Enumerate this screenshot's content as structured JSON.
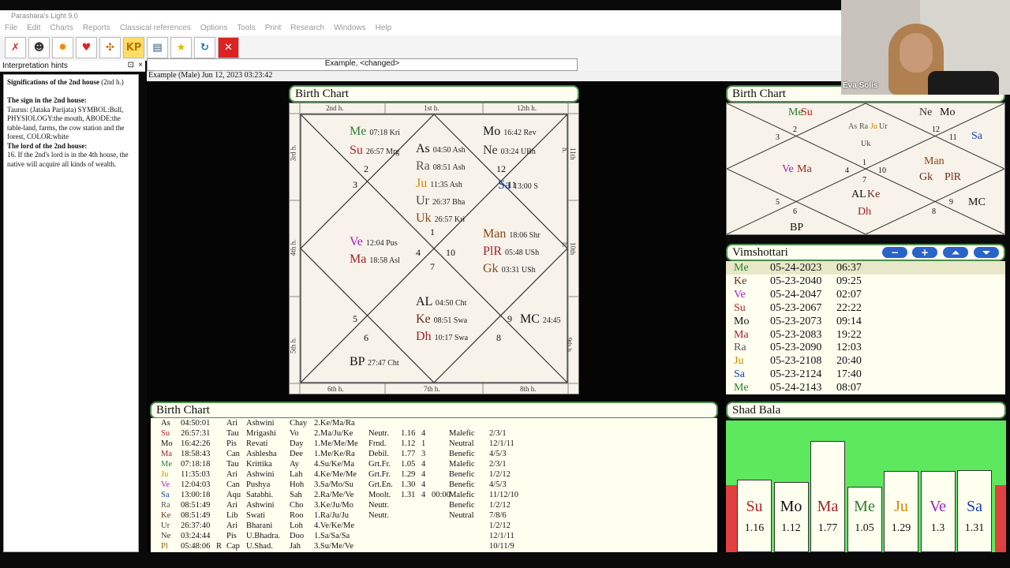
{
  "app": {
    "title": "Parashara's Light 9.0",
    "menu": [
      "File",
      "Edit",
      "Charts",
      "Reports",
      "Classical references",
      "Options",
      "Tools",
      "Print",
      "Research",
      "Windows",
      "Help"
    ],
    "toolbar": [
      "tools-icon",
      "profile-icon",
      "sun-icon",
      "heart-icon",
      "wheel-icon",
      "kp-icon",
      "report-icon",
      "star-icon",
      "refresh-icon",
      "close-icon"
    ],
    "kp_label": "KP"
  },
  "hints": {
    "header": "Interpretation hints",
    "pin": "⊡",
    "close": "×",
    "title": "Significations of the 2nd house",
    "title_suffix": " (2nd h.)",
    "sign_heading": "The sign in the 2nd house:",
    "sign_text": "Taurus: (Jataka Parijata) SYMBOL:Bull, PHYSIOLOGY:the mouth, ABODE:the table-land, farms, the cow station and the forest, COLOR:white",
    "lord_heading": "The lord of the 2nd house:",
    "lord_text": "16. If the 2nd's lord is in the 4th house, the native will acquire all kinds of wealth."
  },
  "tab": {
    "label": "Example,   <changed>"
  },
  "info": {
    "text": "Example (Male) Jun 12, 2023 03:23:42"
  },
  "main_chart": {
    "title": "Birth Chart",
    "house_labels": {
      "top": [
        "2nd h.",
        "1st h.",
        "12th h."
      ],
      "bottom": [
        "6th h.",
        "7th h.",
        "8th h."
      ],
      "left": [
        "3rd h.",
        "4th h.",
        "5th h."
      ],
      "right": [
        "11th h.",
        "10th h.",
        "9th h."
      ]
    },
    "signs": [
      "1",
      "2",
      "3",
      "4",
      "5",
      "6",
      "7",
      "8",
      "9",
      "10",
      "11",
      "12"
    ],
    "planets": [
      {
        "p": "Me",
        "d": "07:18 Kri"
      },
      {
        "p": "Su",
        "d": "26:57 Mrg"
      },
      {
        "p": "Mo",
        "d": "16:42 Rev"
      },
      {
        "p": "Ne",
        "d": "03:24 UBh"
      },
      {
        "p": "As",
        "d": "04:50 Ash"
      },
      {
        "p": "Ra",
        "d": "08:51 Ash"
      },
      {
        "p": "Ju",
        "d": "11:35 Ash"
      },
      {
        "p": "Ur",
        "d": "26:37 Bha"
      },
      {
        "p": "Uk",
        "d": "26:57 Kri"
      },
      {
        "p": "Sa",
        "d": "13:00 S"
      },
      {
        "p": "Ve",
        "d": "12:04 Pus"
      },
      {
        "p": "Ma",
        "d": "18:58 Asl"
      },
      {
        "p": "Man",
        "d": "18:06 Shr"
      },
      {
        "p": "PlR",
        "d": "05:48 USh"
      },
      {
        "p": "Gk",
        "d": "03:31 USh"
      },
      {
        "p": "AL",
        "d": "04:50 Cht"
      },
      {
        "p": "Ke",
        "d": "08:51 Swa"
      },
      {
        "p": "Dh",
        "d": "10:17 Swa"
      },
      {
        "p": "MC",
        "d": "24:45"
      },
      {
        "p": "BP",
        "d": "27:47 Cht"
      }
    ]
  },
  "small_chart": {
    "title": "Birth Chart",
    "items": [
      "Me",
      "Su",
      "Ne",
      "Mo",
      "As",
      "Ra",
      "Ju",
      "Ur",
      "Uk",
      "Sa",
      "Ve",
      "Ma",
      "Man",
      "Gk",
      "PlR",
      "AL",
      "Ke",
      "Dh",
      "MC",
      "BP"
    ],
    "signs": [
      "1",
      "2",
      "3",
      "4",
      "5",
      "6",
      "7",
      "8",
      "9",
      "10",
      "11",
      "12"
    ]
  },
  "vimshottari": {
    "title": "Vimshottari",
    "buttons": [
      "−",
      "+",
      "⏶",
      "⏷"
    ],
    "rows": [
      [
        "Me",
        "05-24-2023",
        "06:37"
      ],
      [
        "Ke",
        "05-23-2040",
        "09:25"
      ],
      [
        "Ve",
        "05-24-2047",
        "02:07"
      ],
      [
        "Su",
        "05-23-2067",
        "22:22"
      ],
      [
        "Mo",
        "05-23-2073",
        "09:14"
      ],
      [
        "Ma",
        "05-23-2083",
        "19:22"
      ],
      [
        "Ra",
        "05-23-2090",
        "12:03"
      ],
      [
        "Ju",
        "05-23-2108",
        "20:40"
      ],
      [
        "Sa",
        "05-23-2124",
        "17:40"
      ],
      [
        "Me",
        "05-24-2143",
        "08:07"
      ]
    ]
  },
  "table": {
    "title": "Birth Chart",
    "rows": [
      [
        "As",
        "04:50:01",
        "",
        "Ari",
        "Ashwini",
        "Chay",
        "2.Ke/Ma/Ra",
        "",
        "",
        "",
        "",
        "",
        ""
      ],
      [
        "Su",
        "26:57:31",
        "",
        "Tau",
        "Mrigashi",
        "Vo",
        "2.Ma/Ju/Ke",
        "Neutr.",
        "1.16",
        "4",
        "",
        "Malefic",
        "2/3/1"
      ],
      [
        "Mo",
        "16:42:26",
        "",
        "Pis",
        "Revati",
        "Day",
        "1.Me/Me/Me",
        "Frnd.",
        "1.12",
        "1",
        "",
        "Neutral",
        "12/1/11"
      ],
      [
        "Ma",
        "18:58:43",
        "",
        "Can",
        "Ashlesha",
        "Dee",
        "1.Me/Ke/Ra",
        "Debil.",
        "1.77",
        "3",
        "",
        "Benefic",
        "4/5/3"
      ],
      [
        "Me",
        "07:18:18",
        "",
        "Tau",
        "Krittika",
        "Ay",
        "4.Su/Ke/Ma",
        "Grt.Fr.",
        "1.05",
        "4",
        "",
        "Malefic",
        "2/3/1"
      ],
      [
        "Ju",
        "11:35:03",
        "",
        "Ari",
        "Ashwini",
        "Lah",
        "4.Ke/Me/Me",
        "Grt.Fr.",
        "1.29",
        "4",
        "",
        "Benefic",
        "1/2/12"
      ],
      [
        "Ve",
        "12:04:03",
        "",
        "Can",
        "Pushya",
        "Hoh",
        "3.Sa/Mo/Su",
        "Grt.En.",
        "1.30",
        "4",
        "",
        "Benefic",
        "4/5/3"
      ],
      [
        "Sa",
        "13:00:18",
        "",
        "Aqu",
        "Satabhi.",
        "Sah",
        "2.Ra/Me/Ve",
        "Moolt.",
        "1.31",
        "4",
        "00:00",
        "Malefic",
        "11/12/10"
      ],
      [
        "Ra",
        "08:51:49",
        "",
        "Ari",
        "Ashwini",
        "Cho",
        "3.Ke/Ju/Mo",
        "Neutr.",
        "",
        "",
        "",
        "Benefic",
        "1/2/12"
      ],
      [
        "Ke",
        "08:51:49",
        "",
        "Lib",
        "Swati",
        "Roo",
        "1.Ra/Ju/Ju",
        "Neutr.",
        "",
        "",
        "",
        "Neutral",
        "7/8/6"
      ],
      [
        "Ur",
        "26:37:40",
        "",
        "Ari",
        "Bharani",
        "Loh",
        "4.Ve/Ke/Me",
        "",
        "",
        "",
        "",
        "",
        "1/2/12"
      ],
      [
        "Ne",
        "03:24:44",
        "",
        "Pis",
        "U.Bhadra.",
        "Doo",
        "1.Sa/Sa/Sa",
        "",
        "",
        "",
        "",
        "",
        "12/1/11"
      ],
      [
        "Pl",
        "05:48:06",
        "R",
        "Cap",
        "U.Shad.",
        "Jah",
        "3.Su/Me/Ve",
        "",
        "",
        "",
        "",
        "",
        "10/11/9"
      ]
    ]
  },
  "shadbala": {
    "title": "Shad Bala",
    "bars": [
      {
        "p": "Su",
        "v": 1.16
      },
      {
        "p": "Mo",
        "v": 1.12
      },
      {
        "p": "Ma",
        "v": 1.77
      },
      {
        "p": "Me",
        "v": 1.05
      },
      {
        "p": "Ju",
        "v": 1.29
      },
      {
        "p": "Ve",
        "v": 1.3
      },
      {
        "p": "Sa",
        "v": 1.31
      }
    ],
    "vmax": 1.9
  },
  "webcam": {
    "name": "Eva Solis"
  }
}
